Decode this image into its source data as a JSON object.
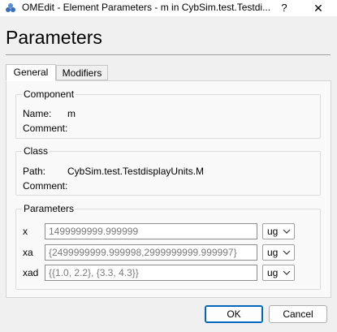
{
  "window": {
    "title": "OMEdit - Element Parameters - m in CybSim.test.Testdi...",
    "help_glyph": "?",
    "close_glyph": "✕"
  },
  "heading": "Parameters",
  "tabs": [
    {
      "label": "General",
      "selected": true
    },
    {
      "label": "Modifiers",
      "selected": false
    }
  ],
  "component": {
    "title": "Component",
    "name_label": "Name:",
    "name_value": "m",
    "comment_label": "Comment:"
  },
  "class_group": {
    "title": "Class",
    "path_label": "Path:",
    "path_value": "CybSim.test.TestdisplayUnits.M",
    "comment_label": "Comment:"
  },
  "parameters": {
    "title": "Parameters",
    "rows": [
      {
        "label": "x",
        "placeholder": "1499999999.999999",
        "unit": "ug"
      },
      {
        "label": "xa",
        "placeholder": "{2499999999.999998,2999999999.999997}",
        "unit": "ug"
      },
      {
        "label": "xad",
        "placeholder": "{{1.0, 2.2}, {3.3, 4.3}}",
        "unit": "ug"
      }
    ]
  },
  "buttons": {
    "ok": "OK",
    "cancel": "Cancel"
  },
  "icons": {
    "app": "omedit-app-icon",
    "dropdown": "chevron-down-icon"
  },
  "colors": {
    "accent": "#0067c0",
    "panel_bg": "#f9f9f9",
    "window_bg": "#f0f0f0"
  }
}
